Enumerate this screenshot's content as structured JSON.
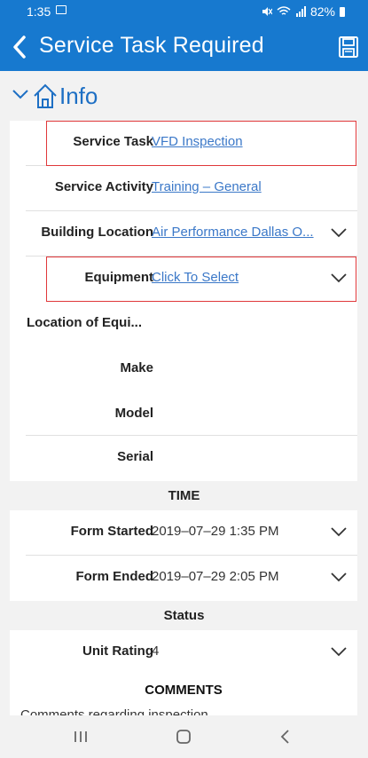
{
  "status_bar": {
    "time": "1:35",
    "battery": "82%",
    "icons": [
      "image-icon",
      "mute-icon",
      "wifi-icon",
      "signal-icon",
      "battery-icon"
    ]
  },
  "app_bar": {
    "title": "Service Task Required",
    "back_icon": "back-arrow-icon",
    "save_icon": "save-icon"
  },
  "section": {
    "label": "Info",
    "icons": [
      "chevron-down-icon",
      "home-icon"
    ]
  },
  "fields": {
    "service_task": {
      "label": "Service Task",
      "value": "VFD Inspection"
    },
    "service_activity": {
      "label": "Service Activity",
      "value": "Training – General"
    },
    "building_location": {
      "label": "Building Location",
      "value": "Air Performance Dallas O..."
    },
    "equipment": {
      "label": "Equipment",
      "value": "Click To Select"
    },
    "location_of_equipment": {
      "label": "Location of Equi...",
      "value": ""
    },
    "make": {
      "label": "Make",
      "value": ""
    },
    "model": {
      "label": "Model",
      "value": ""
    },
    "serial": {
      "label": "Serial",
      "value": ""
    }
  },
  "time_section": {
    "header": "TIME",
    "form_started": {
      "label": "Form Started",
      "value": "2019–07–29 1:35 PM"
    },
    "form_ended": {
      "label": "Form Ended",
      "value": "2019–07–29 2:05 PM"
    }
  },
  "status_section": {
    "header": "Status",
    "unit_rating": {
      "label": "Unit Rating",
      "value": "4"
    }
  },
  "comments_section": {
    "header": "COMMENTS",
    "placeholder": "Comments regarding inspection"
  },
  "colors": {
    "primary": "#1779cf",
    "link": "#3b78c8",
    "highlight": "#e0383a"
  }
}
